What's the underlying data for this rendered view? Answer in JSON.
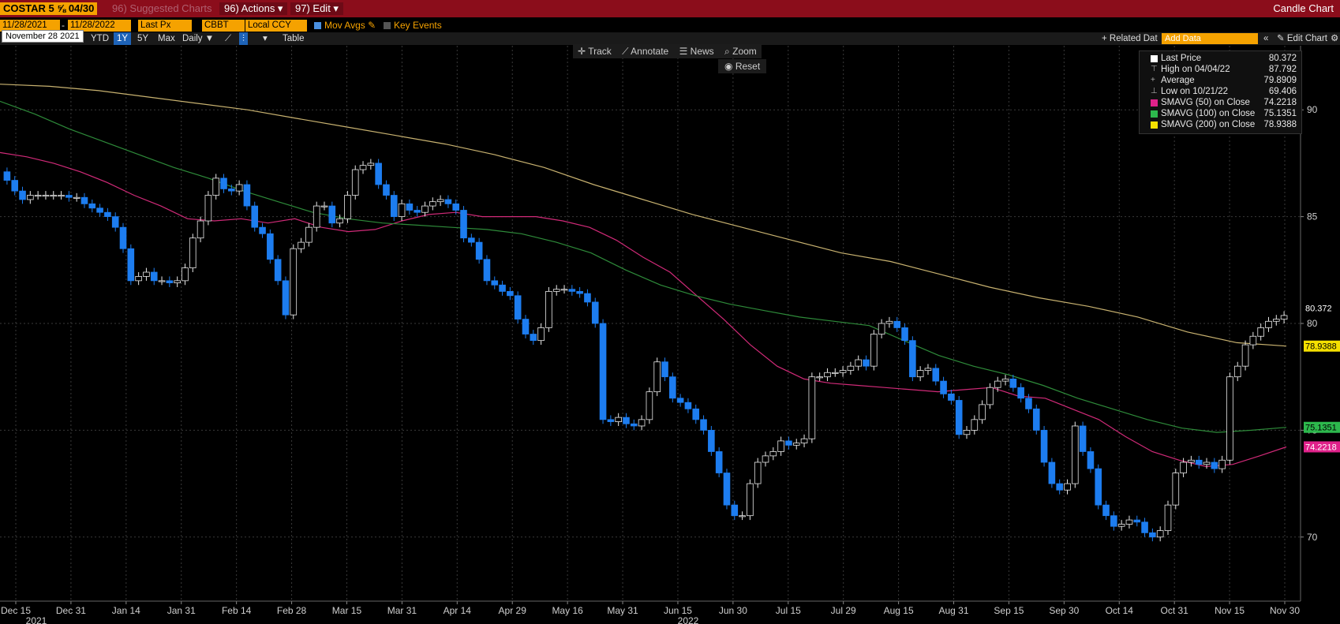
{
  "header": {
    "ticker": "COSTAR 5 ⅝ 04/30",
    "suggested": "96) Suggested Charts",
    "actions": "96) Actions ▾",
    "edit": "97) Edit ▾",
    "title": "Candle Chart"
  },
  "controls": {
    "start_date": "11/28/2021",
    "end_date": "11/28/2022",
    "field1": "Last Px",
    "field2": "CBBT",
    "field3": "Local CCY",
    "mov_avgs": "Mov Avgs",
    "key_events": "Key Events",
    "related_data": "+ Related Dat",
    "add_data_placeholder": "Add Data",
    "edit_chart": "Edit Chart",
    "tooltip_date": "November 28 2021",
    "periods": [
      "YTD",
      "1Y",
      "5Y",
      "Max"
    ],
    "frequency": "Daily ▼",
    "table": "Table",
    "selected_period": "1Y"
  },
  "tools": {
    "track": "Track",
    "annotate": "Annotate",
    "news": "News",
    "zoom": "Zoom",
    "reset": "Reset"
  },
  "legend": {
    "rows": [
      {
        "label": "Last Price",
        "value": "80.372",
        "color": "#ffffff"
      },
      {
        "label": "High on 04/04/22",
        "value": "87.792",
        "color": ""
      },
      {
        "label": "Average",
        "value": "79.8909",
        "color": ""
      },
      {
        "label": "Low on 10/21/22",
        "value": "69.406",
        "color": ""
      },
      {
        "label": "SMAVG (50)  on Close",
        "value": "74.2218",
        "color": "#e0218a"
      },
      {
        "label": "SMAVG (100)  on Close",
        "value": "75.1351",
        "color": "#2db84d"
      },
      {
        "label": "SMAVG (200)  on Close",
        "value": "78.9388",
        "color": "#f5e000"
      }
    ]
  },
  "chart_data": {
    "type": "candlestick",
    "ylim": [
      67,
      93
    ],
    "yticks": [
      70,
      75,
      80,
      85,
      90
    ],
    "x_tick_labels": [
      "Dec 15",
      "Dec 31",
      "Jan 14",
      "Jan 31",
      "Feb 14",
      "Feb 28",
      "Mar 15",
      "Mar 31",
      "Apr 14",
      "Apr 29",
      "May 16",
      "May 31",
      "Jun 15",
      "Jun 30",
      "Jul 15",
      "Jul 29",
      "Aug 15",
      "Aug 31",
      "Sep 15",
      "Sep 30",
      "Oct 14",
      "Oct 31",
      "Nov 15",
      "Nov 30"
    ],
    "year_labels": [
      "2021",
      "2022"
    ],
    "price_closes": [
      86.7,
      86.2,
      85.8,
      86.0,
      86.0,
      86.0,
      86.0,
      86.0,
      85.9,
      85.9,
      85.6,
      85.4,
      85.2,
      85.0,
      84.5,
      83.5,
      82.0,
      82.2,
      82.4,
      82.0,
      82.0,
      81.9,
      82.0,
      82.6,
      84.0,
      84.8,
      86.0,
      86.8,
      86.3,
      86.2,
      86.5,
      85.5,
      84.5,
      84.2,
      83.0,
      82.0,
      80.4,
      83.5,
      83.8,
      84.5,
      85.5,
      85.5,
      84.7,
      84.9,
      86.0,
      87.2,
      87.4,
      87.5,
      86.5,
      86.0,
      85.0,
      85.6,
      85.3,
      85.2,
      85.5,
      85.7,
      85.8,
      85.6,
      85.3,
      84.0,
      83.8,
      83.0,
      82.0,
      81.8,
      81.5,
      81.3,
      80.2,
      79.5,
      79.2,
      79.8,
      81.5,
      81.6,
      81.6,
      81.5,
      81.4,
      81.0,
      80.0,
      75.5,
      75.4,
      75.6,
      75.3,
      75.2,
      75.5,
      76.8,
      78.2,
      77.5,
      76.5,
      76.3,
      76.0,
      75.5,
      75.0,
      74.0,
      73.0,
      71.5,
      71.0,
      71.0,
      72.5,
      73.5,
      73.8,
      74.0,
      74.5,
      74.3,
      74.4,
      74.6,
      77.5,
      77.5,
      77.7,
      77.7,
      77.8,
      78.0,
      78.3,
      78.0,
      79.5,
      80.0,
      80.1,
      79.8,
      79.2,
      77.5,
      77.8,
      77.9,
      77.3,
      76.7,
      76.4,
      74.8,
      75.0,
      75.5,
      76.2,
      77.0,
      77.3,
      77.4,
      77.0,
      76.5,
      76.0,
      75.0,
      73.5,
      72.5,
      72.2,
      72.5,
      75.2,
      74.0,
      73.2,
      71.5,
      71.0,
      70.5,
      70.6,
      70.8,
      70.7,
      70.2,
      70.0,
      70.3,
      71.5,
      73.0,
      73.5,
      73.6,
      73.4,
      73.5,
      73.2,
      73.6,
      77.5,
      78.0,
      79.0,
      79.4,
      79.8,
      80.1,
      80.2,
      80.372
    ],
    "legend_placement": "top-right",
    "grid": true,
    "last_price": 80.372,
    "series": [
      {
        "name": "SMAVG (50)  on Close",
        "color": "#d02a78",
        "last": 74.2218,
        "values": [
          88.0,
          87.8,
          87.5,
          87.1,
          86.6,
          86.0,
          85.5,
          84.9,
          84.8,
          84.9,
          84.7,
          84.9,
          84.5,
          84.3,
          84.4,
          84.8,
          85.1,
          85.2,
          85.0,
          85.0,
          85.0,
          84.8,
          84.5,
          83.9,
          83.1,
          82.4,
          81.3,
          80.2,
          79.0,
          78.0,
          77.4,
          77.2,
          77.1,
          77.0,
          76.9,
          76.8,
          76.9,
          77.0,
          76.6,
          76.5,
          76.0,
          75.5,
          74.7,
          74.0,
          73.6,
          73.3,
          73.4,
          73.8,
          74.2218
        ]
      },
      {
        "name": "SMAVG (100)  on Close",
        "color": "#2e8b3a",
        "last": 75.1351,
        "values": [
          90.4,
          89.8,
          89.1,
          88.5,
          87.9,
          87.3,
          86.8,
          86.2,
          85.7,
          85.2,
          84.9,
          84.7,
          84.6,
          84.5,
          84.4,
          84.2,
          83.8,
          83.3,
          82.5,
          81.8,
          81.3,
          80.9,
          80.6,
          80.3,
          80.1,
          79.9,
          79.2,
          78.5,
          78.0,
          77.6,
          77.1,
          76.5,
          76.0,
          75.5,
          75.1,
          74.9,
          75.0,
          75.1351
        ]
      },
      {
        "name": "SMAVG (200)  on Close",
        "color": "#c8b270",
        "last": 78.9388,
        "values": [
          91.2,
          91.1,
          90.9,
          90.6,
          90.3,
          90.0,
          89.6,
          89.2,
          88.8,
          88.4,
          87.9,
          87.3,
          86.5,
          85.8,
          85.1,
          84.5,
          83.9,
          83.3,
          82.9,
          82.3,
          81.7,
          81.2,
          80.8,
          80.3,
          79.6,
          79.1,
          78.9388
        ]
      }
    ]
  }
}
